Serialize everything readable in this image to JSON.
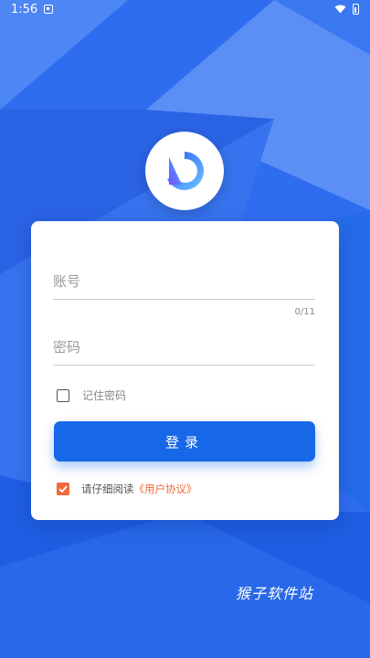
{
  "status_bar": {
    "time": "1:56"
  },
  "login_form": {
    "account_placeholder": "账号",
    "account_counter": "0/11",
    "password_placeholder": "密码",
    "remember_label": "记住密码",
    "login_button": "登录",
    "agree_text": "请仔细阅读",
    "agreement_link": "《用户协议》"
  },
  "watermark": "猴子软件站",
  "colors": {
    "background": "#2f6df0",
    "primary_button": "#1768e8",
    "accent": "#f06a3a"
  },
  "icons": {
    "logo": "app-logo-icon",
    "checkbox_remember": "checkbox-unchecked",
    "checkbox_agree": "checkbox-checked"
  }
}
